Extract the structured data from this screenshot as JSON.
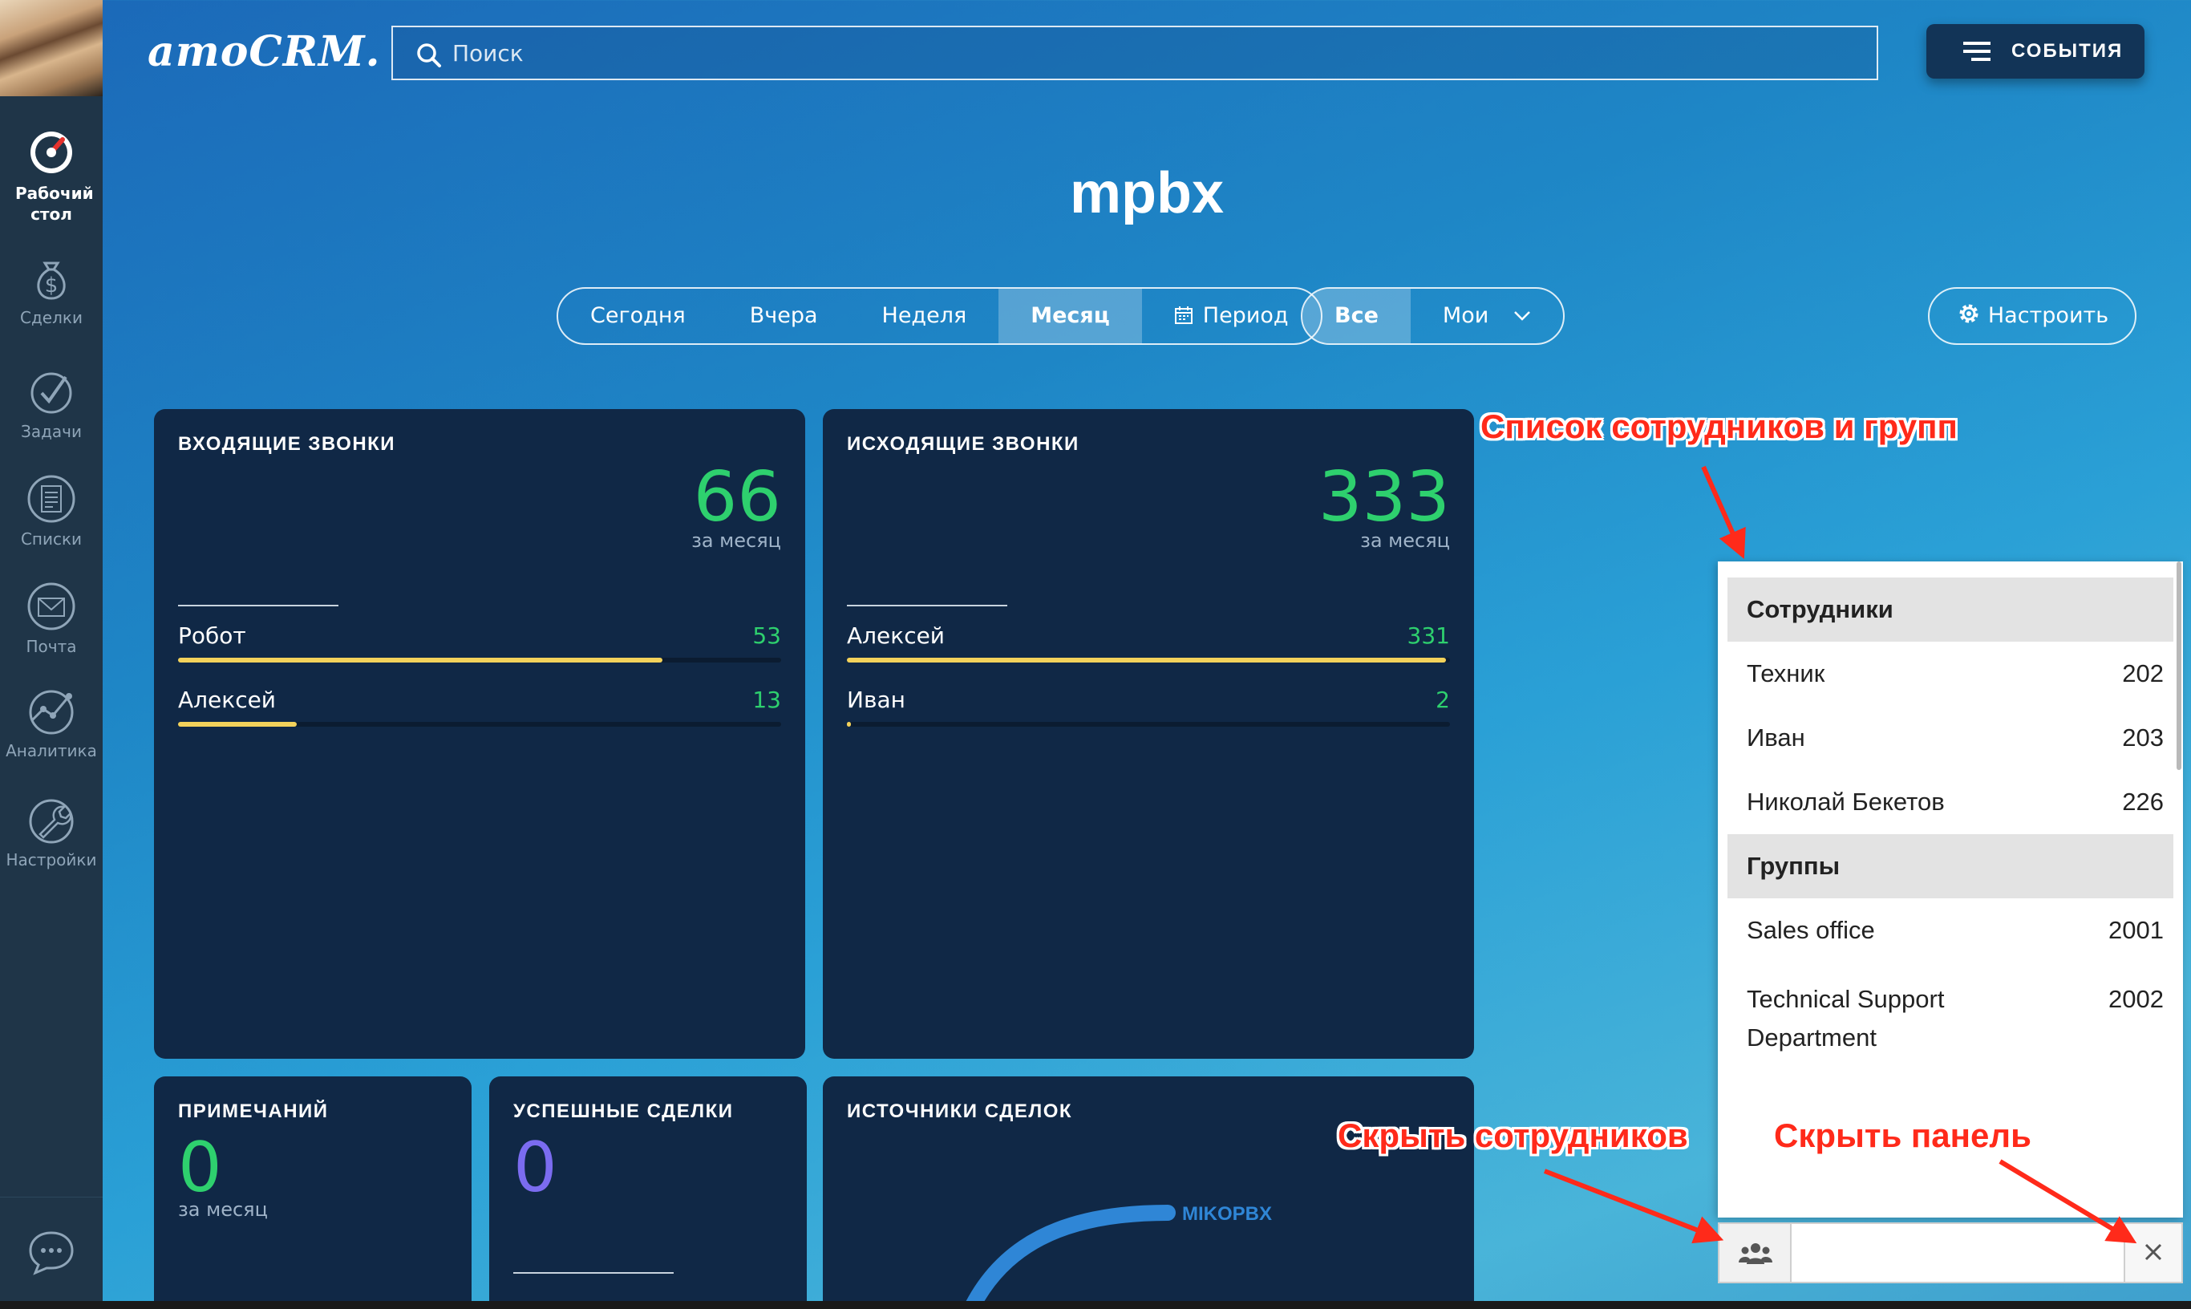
{
  "sidebar": {
    "items": [
      {
        "label": "Рабочий стол",
        "icon": "dashboard-icon"
      },
      {
        "label": "Сделки",
        "icon": "money-bag-icon"
      },
      {
        "label": "Задачи",
        "icon": "check-circle-icon"
      },
      {
        "label": "Списки",
        "icon": "list-icon"
      },
      {
        "label": "Почта",
        "icon": "mail-icon"
      },
      {
        "label": "Аналитика",
        "icon": "analytics-icon"
      },
      {
        "label": "Настройки",
        "icon": "wrench-icon"
      }
    ],
    "chat_icon": "chat-icon"
  },
  "header": {
    "brand": "amoCRM.",
    "search_placeholder": "Поиск",
    "events_label": "СОБЫТИЯ"
  },
  "page_title": "mpbx",
  "filters": {
    "periods": [
      "Сегодня",
      "Вчера",
      "Неделя",
      "Месяц",
      "Период"
    ],
    "selected_period": "Месяц",
    "owners": [
      "Все",
      "Мои"
    ],
    "selected_owner": "Все",
    "configure_label": "Настроить"
  },
  "cards": {
    "incoming": {
      "title": "ВХОДЯЩИЕ ЗВОНКИ",
      "value": "66",
      "period": "за месяц",
      "rows": [
        {
          "name": "Робот",
          "count": "53",
          "fraction": 0.803
        },
        {
          "name": "Алексей",
          "count": "13",
          "fraction": 0.197
        }
      ]
    },
    "outgoing": {
      "title": "ИСХОДЯЩИЕ ЗВОНКИ",
      "value": "333",
      "period": "за месяц",
      "rows": [
        {
          "name": "Алексей",
          "count": "331",
          "fraction": 0.994
        },
        {
          "name": "Иван",
          "count": "2",
          "fraction": 0.006
        }
      ]
    },
    "notes": {
      "title": "ПРИМЕЧАНИЙ",
      "value": "0",
      "period": "за месяц"
    },
    "success": {
      "title": "УСПЕШНЫЕ СДЕЛКИ",
      "value": "0"
    },
    "sources": {
      "title": "ИСТОЧНИКИ СДЕЛОК",
      "legend": "MIKOPBX"
    }
  },
  "panel": {
    "employees_header": "Сотрудники",
    "employees": [
      {
        "name": "Техник",
        "ext": "202"
      },
      {
        "name": "Иван",
        "ext": "203"
      },
      {
        "name": "Николай Бекетов",
        "ext": "226"
      }
    ],
    "groups_header": "Группы",
    "groups": [
      {
        "name": "Sales office",
        "ext": "2001"
      },
      {
        "name": "Technical Support Department",
        "ext": "2002"
      }
    ]
  },
  "annotations": {
    "list": "Список сотрудников и групп",
    "hide_employees": "Скрыть сотрудников",
    "hide_panel": "Скрыть панель"
  },
  "colors": {
    "accent_green": "#2ed06e",
    "bar_yellow": "#f3d25b",
    "card_bg": "#102846",
    "success_purple": "#7b6cf0",
    "annotation_red": "#ff2a1a"
  }
}
